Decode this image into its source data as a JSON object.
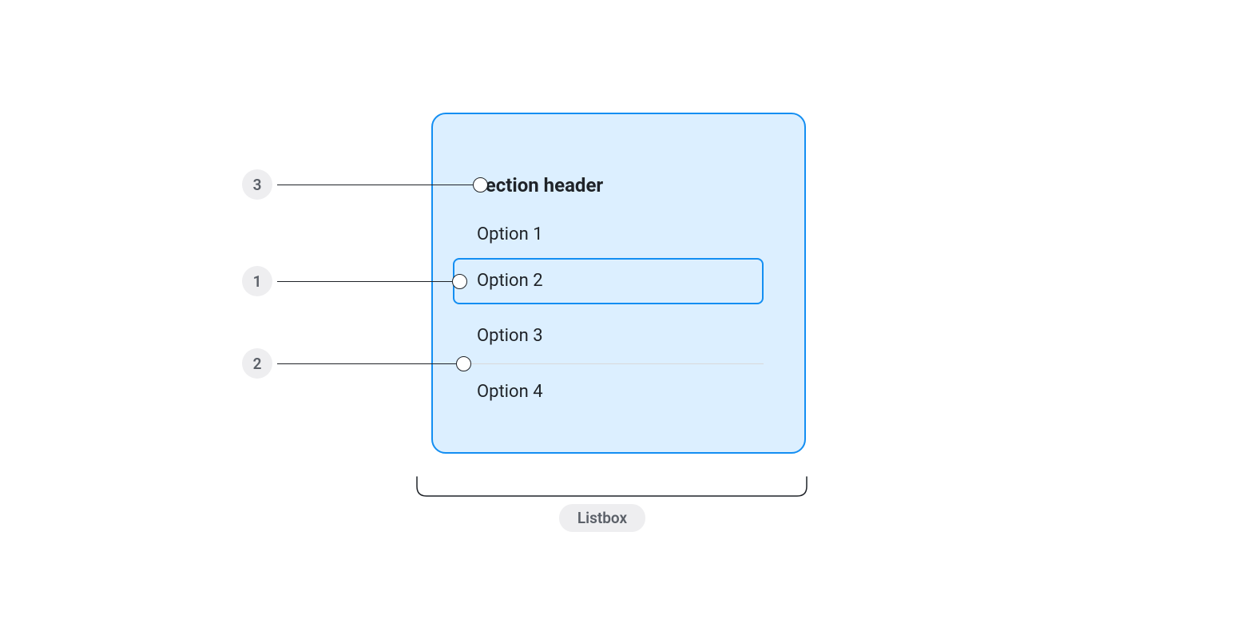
{
  "listbox": {
    "section_header": "Section header",
    "options": [
      "Option 1",
      "Option 2",
      "Option 3",
      "Option 4"
    ]
  },
  "callouts": {
    "section_header_num": "3",
    "selected_option_num": "1",
    "divider_num": "2"
  },
  "bottom_label": "Listbox"
}
